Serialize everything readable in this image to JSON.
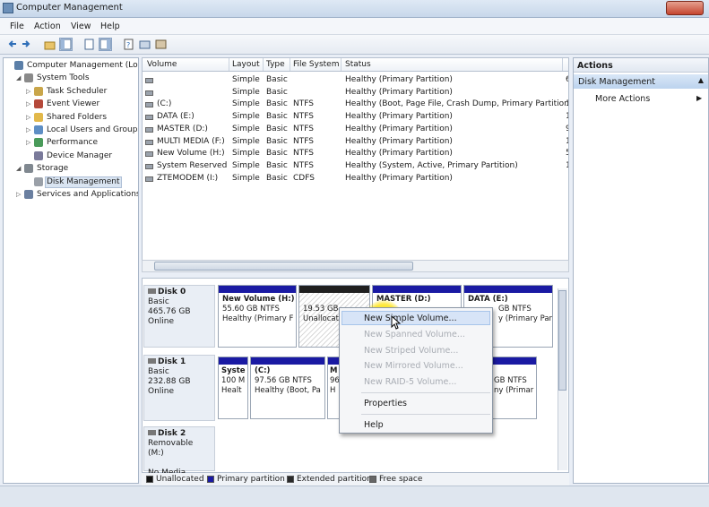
{
  "window": {
    "title": "Computer Management"
  },
  "menu": [
    "File",
    "Action",
    "View",
    "Help"
  ],
  "tree": [
    {
      "label": "Computer Management (Local",
      "icon": "computer-icon",
      "indent": 0,
      "expander": ""
    },
    {
      "label": "System Tools",
      "icon": "tools-icon",
      "indent": 1,
      "expander": "▲"
    },
    {
      "label": "Task Scheduler",
      "icon": "clock-icon",
      "indent": 2,
      "expander": "▶"
    },
    {
      "label": "Event Viewer",
      "icon": "event-viewer-icon",
      "indent": 2,
      "expander": "▶"
    },
    {
      "label": "Shared Folders",
      "icon": "shared-folder-icon",
      "indent": 2,
      "expander": "▶"
    },
    {
      "label": "Local Users and Groups",
      "icon": "users-icon",
      "indent": 2,
      "expander": "▶"
    },
    {
      "label": "Performance",
      "icon": "performance-icon",
      "indent": 2,
      "expander": "▶"
    },
    {
      "label": "Device Manager",
      "icon": "device-manager-icon",
      "indent": 2,
      "expander": ""
    },
    {
      "label": "Storage",
      "icon": "storage-icon",
      "indent": 1,
      "expander": "▲"
    },
    {
      "label": "Disk Management",
      "icon": "disk-icon",
      "indent": 2,
      "expander": "",
      "selected": true
    },
    {
      "label": "Services and Applications",
      "icon": "services-icon",
      "indent": 1,
      "expander": "▶"
    }
  ],
  "volume_table": {
    "columns": [
      "Volume",
      "Layout",
      "Type",
      "File System",
      "Status"
    ],
    "rows": [
      {
        "volume": "",
        "layout": "Simple",
        "type": "Basic",
        "fs": "",
        "status": "Healthy (Primary Partition)",
        "extra": "6"
      },
      {
        "volume": "",
        "layout": "Simple",
        "type": "Basic",
        "fs": "",
        "status": "Healthy (Primary Partition)",
        "extra": ""
      },
      {
        "volume": "(C:)",
        "layout": "Simple",
        "type": "Basic",
        "fs": "NTFS",
        "status": "Healthy (Boot, Page File, Crash Dump, Primary Partition)",
        "extra": "1"
      },
      {
        "volume": "DATA (E:)",
        "layout": "Simple",
        "type": "Basic",
        "fs": "NTFS",
        "status": "Healthy (Primary Partition)",
        "extra": "1"
      },
      {
        "volume": "MASTER (D:)",
        "layout": "Simple",
        "type": "Basic",
        "fs": "NTFS",
        "status": "Healthy (Primary Partition)",
        "extra": "9"
      },
      {
        "volume": "MULTI MEDIA (F:)",
        "layout": "Simple",
        "type": "Basic",
        "fs": "NTFS",
        "status": "Healthy (Primary Partition)",
        "extra": "1"
      },
      {
        "volume": "New Volume (H:)",
        "layout": "Simple",
        "type": "Basic",
        "fs": "NTFS",
        "status": "Healthy (Primary Partition)",
        "extra": "5"
      },
      {
        "volume": "System Reserved",
        "layout": "Simple",
        "type": "Basic",
        "fs": "NTFS",
        "status": "Healthy (System, Active, Primary Partition)",
        "extra": "1"
      },
      {
        "volume": "ZTEMODEM (I:)",
        "layout": "Simple",
        "type": "Basic",
        "fs": "CDFS",
        "status": "Healthy (Primary Partition)",
        "extra": ""
      }
    ]
  },
  "disks": {
    "disk0": {
      "name": "Disk 0",
      "type": "Basic",
      "size": "465.76 GB",
      "state": "Online",
      "parts": {
        "newvol": {
          "name": "New Volume (H:)",
          "size": "55.60 GB NTFS",
          "status": "Healthy (Primary F"
        },
        "unalloc": {
          "name": "",
          "size": "19.53 GB",
          "status": "Unallocat"
        },
        "master": {
          "name": "MASTER (D:)",
          "size": "",
          "status": ""
        },
        "data": {
          "name": "DATA (E:)",
          "size": "GB NTFS",
          "status": "y (Primary Part"
        }
      }
    },
    "disk1": {
      "name": "Disk 1",
      "type": "Basic",
      "size": "232.88 GB",
      "state": "Online",
      "parts": {
        "sys": {
          "name": "Syste",
          "size": "100 M",
          "status": "Healt"
        },
        "c": {
          "name": "(C:)",
          "size": "97.56 GB NTFS",
          "status": "Healthy (Boot, Pa"
        },
        "m": {
          "name": "M",
          "size": "96",
          "status": "H"
        },
        "last": {
          "name": "",
          "size": "GB NTFS",
          "status": "ny (Primar"
        }
      }
    },
    "disk2": {
      "name": "Disk 2",
      "type": "Removable (M:)",
      "media": "No Media"
    }
  },
  "legend": [
    "Unallocated",
    "Primary partition",
    "Extended partition",
    "Free space"
  ],
  "legend_colors": {
    "unallocated": "#111111",
    "primary": "#1a1aa3",
    "extended": "#2a2a2a",
    "free": "#666666"
  },
  "context_menu": {
    "items": [
      "New Simple Volume...",
      "New Spanned Volume...",
      "New Striped Volume...",
      "New Mirrored Volume...",
      "New RAID-5 Volume..."
    ],
    "properties": "Properties",
    "help": "Help"
  },
  "actions": {
    "header": "Actions",
    "selected": "Disk Management",
    "more": "More Actions"
  }
}
